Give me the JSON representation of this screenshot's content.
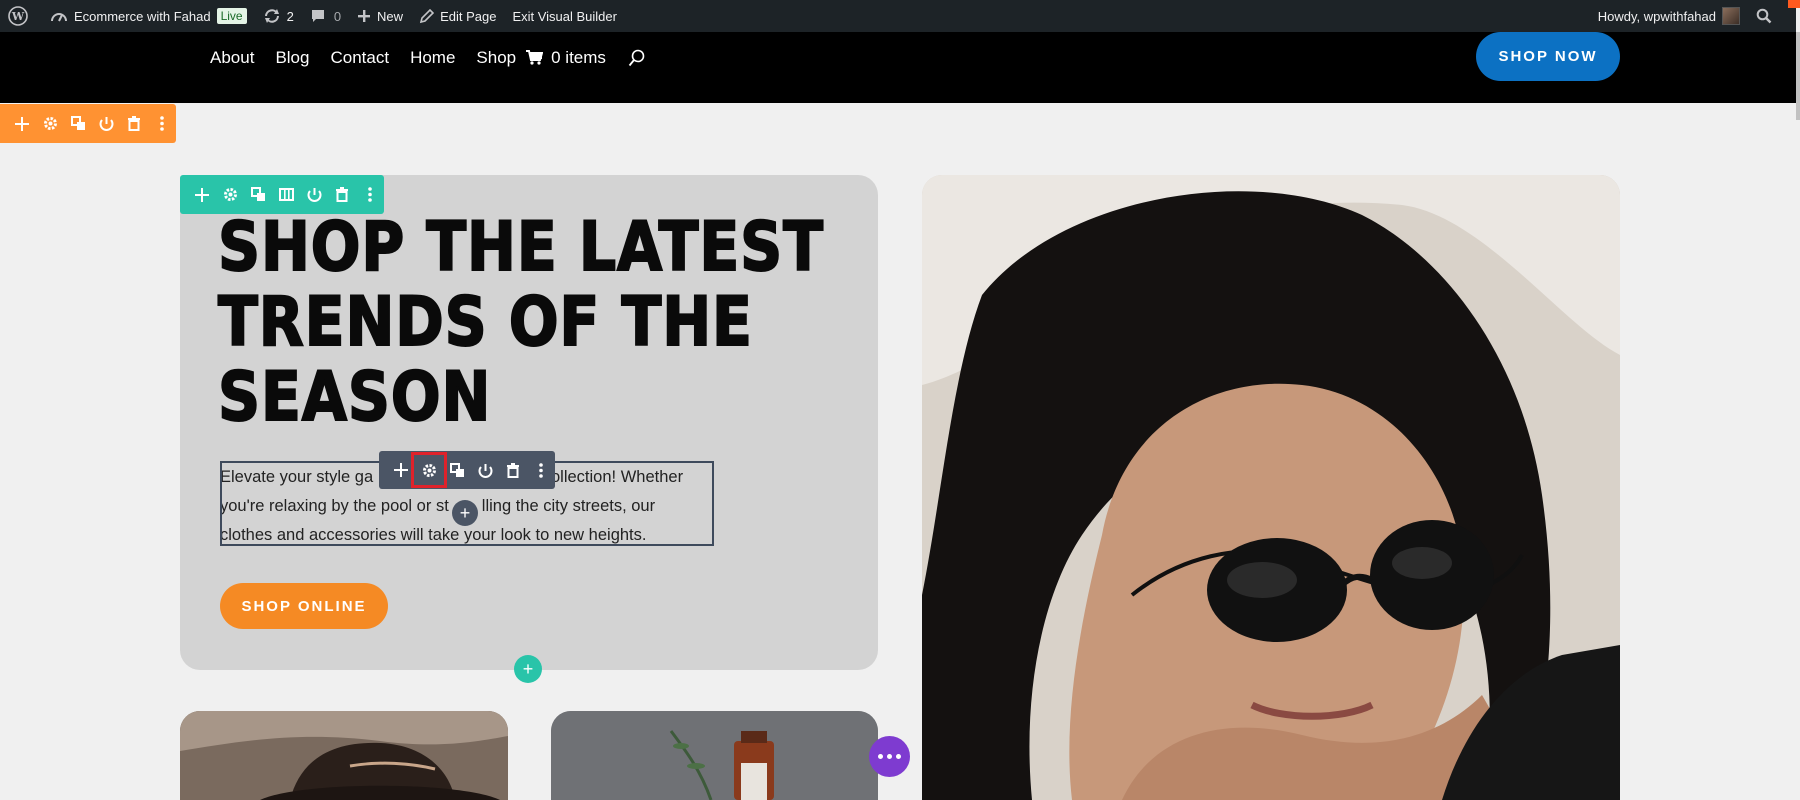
{
  "admin_bar": {
    "site_name": "Ecommerce with Fahad",
    "live_badge": "Live",
    "updates_count": "2",
    "comments_count": "0",
    "new_label": "New",
    "edit_page_label": "Edit Page",
    "exit_builder_label": "Exit Visual Builder",
    "howdy_label": "Howdy, wpwithfahad"
  },
  "header": {
    "nav": [
      "About",
      "Blog",
      "Contact",
      "Home",
      "Shop"
    ],
    "cart_label": "0 items",
    "cta_label": "SHOP NOW"
  },
  "hero": {
    "title_lines": [
      "SHOP THE LATEST",
      "TRENDS OF THE",
      "SEASON"
    ],
    "description_lines": [
      "Elevate your style ga           collection! Whether",
      "you're relaxing by the pool or st  lling the city streets, our",
      "clothes and accessories will take your look to new heights."
    ],
    "cta_label": "SHOP ONLINE"
  },
  "builder": {
    "add_symbol": "+"
  },
  "colors": {
    "admin_bar": "#1d2327",
    "section_toolbar": "#ff9232",
    "row_toolbar": "#29c4a9",
    "module_toolbar": "#4b5565",
    "shop_now": "#0c71c3",
    "shop_online": "#f58a24",
    "settings_highlight": "#e0222b",
    "page_settings": "#7e3bd0"
  }
}
